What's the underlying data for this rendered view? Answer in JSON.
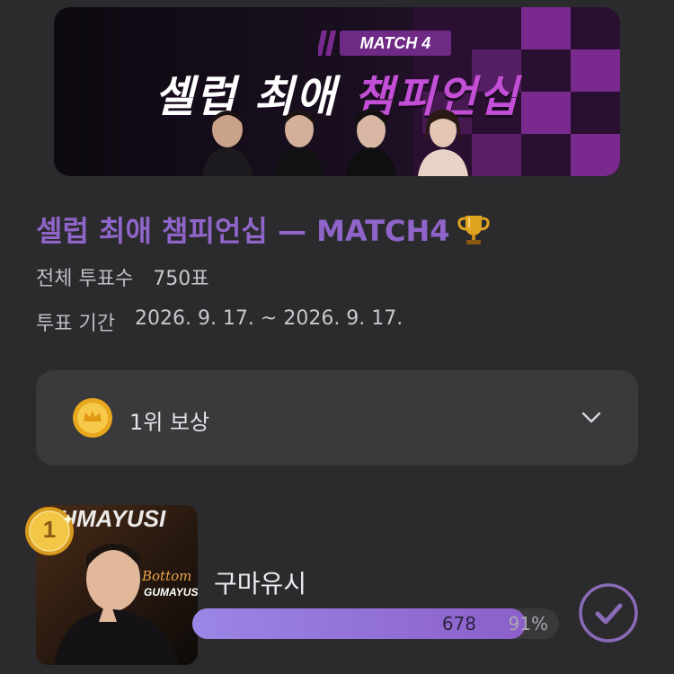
{
  "banner": {
    "badge": "MATCH 4",
    "title_left": "셀럽 최애 ",
    "title_right": "챔피언십"
  },
  "match": {
    "title": "셀럽 최애 챔피언십 — MATCH4",
    "trophy_icon": "trophy-icon"
  },
  "info": {
    "total_votes_label": "전체 투표수",
    "total_votes_value": "750표",
    "period_label": "투표 기간",
    "period_value": "2026. 9. 17. ~ 2026. 9. 17."
  },
  "reward": {
    "label": "1위 보상",
    "icon": "coin-icon"
  },
  "candidates": [
    {
      "rank": "1",
      "name": "구마유시",
      "votes": "678",
      "percent_text": "91%",
      "percent": 0.91,
      "photo_text_top": "Bottom",
      "photo_text_main": "GUMAYUSI"
    }
  ],
  "colors": {
    "accent": "#8f65c9",
    "bar_start": "#9b86e6",
    "bar_end": "#8b5fc9",
    "background": "#2b2b2d",
    "card": "#3a3a3c"
  }
}
